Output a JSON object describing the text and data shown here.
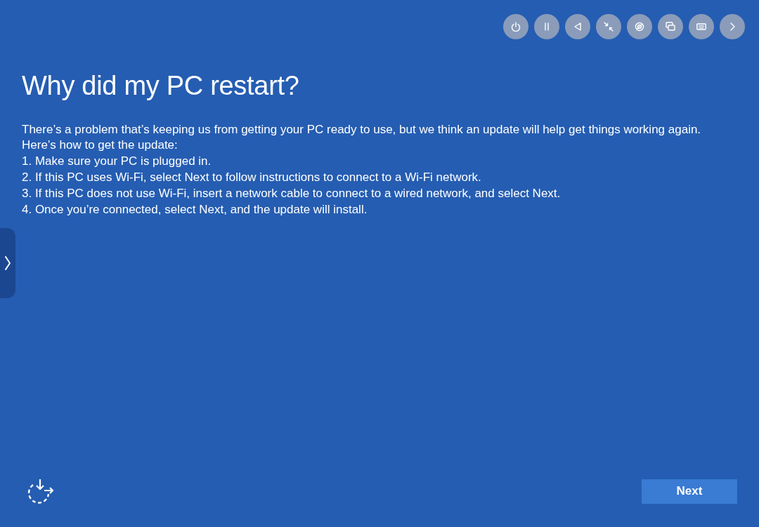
{
  "title": "Why did my PC restart?",
  "message": {
    "lines": [
      "There’s a problem that’s keeping us from getting your PC ready to use, but we think an update will help get things working again.",
      "Here’s how to get the update:",
      "1. Make sure your PC is plugged in.",
      "2. If this PC uses Wi-Fi, select Next to follow instructions to connect to a Wi-Fi network.",
      "3. If this PC does not use Wi-Fi, insert a network cable to connect to a wired network, and select Next.",
      "4. Once you’re connected, select Next, and the update will install."
    ]
  },
  "next_button": {
    "label": "Next"
  }
}
